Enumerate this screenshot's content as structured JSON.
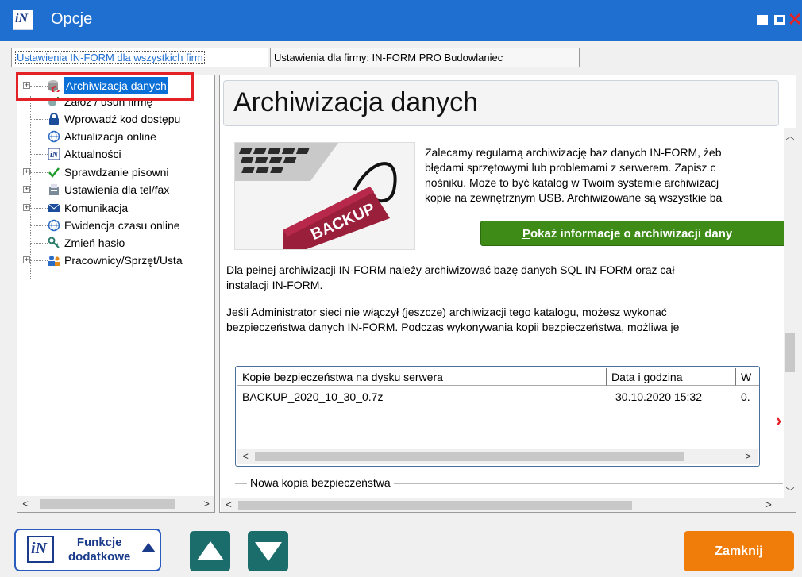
{
  "window": {
    "title": "Opcje",
    "logo_text": "iN"
  },
  "tabs": [
    {
      "label": "Ustawienia IN-FORM dla wszystkich firm",
      "active": true
    },
    {
      "label": "Ustawienia dla firmy: IN-FORM PRO Budowlaniec",
      "active": false
    }
  ],
  "tree": {
    "items": [
      {
        "label": "Archiwizacja danych",
        "icon": "archive-icon",
        "expandable": true,
        "selected": true
      },
      {
        "label": "Załóż / usuń firmę",
        "icon": "add-company-icon",
        "expandable": false
      },
      {
        "label": "Wprowadź kod dostępu",
        "icon": "lock-icon",
        "expandable": false
      },
      {
        "label": "Aktualizacja online",
        "icon": "globe-icon",
        "expandable": false
      },
      {
        "label": "Aktualności",
        "icon": "inform-logo-icon",
        "expandable": false
      },
      {
        "label": "Sprawdzanie pisowni",
        "icon": "checkmark-icon",
        "expandable": true
      },
      {
        "label": "Ustawienia dla tel/fax",
        "icon": "phone-fax-icon",
        "expandable": true
      },
      {
        "label": "Komunikacja",
        "icon": "envelope-icon",
        "expandable": true
      },
      {
        "label": "Ewidencja czasu online",
        "icon": "globe-icon",
        "expandable": false
      },
      {
        "label": "Zmień hasło",
        "icon": "key-icon",
        "expandable": false
      },
      {
        "label": "Pracownicy/Sprzęt/Usta",
        "icon": "people-icon",
        "expandable": true
      }
    ]
  },
  "main": {
    "heading": "Archiwizacja danych",
    "image_label": "BACKUP",
    "para1_lines": [
      "Zalecamy regularną archiwizację baz danych IN-FORM, żeb",
      "błędami sprzętowymi lub problemami z serwerem. Zapisz c",
      "nośniku. Może to być katalog w Twoim systemie archiwizacj",
      "kopie na zewnętrznym USB. Archiwizowane są wszystkie ba"
    ],
    "info_button": {
      "hotkey": "P",
      "rest": "okaż informacje o archiwizacji dany"
    },
    "para2_lines": [
      "Dla pełnej archiwizacji IN-FORM należy archiwizować bazę danych SQL IN-FORM oraz cał",
      "instalacji IN-FORM."
    ],
    "para3_lines": [
      "Jeśli Administrator sieci nie włączył (jeszcze) archiwizacji tego katalogu, możesz wykonać",
      "bezpieczeństwa danych IN-FORM. Podczas wykonywania kopii bezpieczeństwa, możliwa je"
    ],
    "table": {
      "columns": [
        "Kopie bezpieczeństwa na dysku serwera",
        "Data i godzina",
        "W"
      ],
      "rows": [
        [
          "BACKUP_2020_10_30_0.7z",
          "30.10.2020 15:32",
          "0."
        ]
      ]
    },
    "group_label": "Nowa kopia bezpieczeństwa"
  },
  "bottom": {
    "func_line1": "Funkcje",
    "func_line2": "dodatkowe",
    "close_hotkey": "Z",
    "close_rest": "amknij"
  },
  "colors": {
    "titlebar": "#1f6fd0",
    "selection": "#0a6fd6",
    "info_button": "#3e8b18",
    "nav_buttons": "#1b6d6c",
    "close_button": "#f07d0a",
    "highlight_box": "#e32228"
  }
}
